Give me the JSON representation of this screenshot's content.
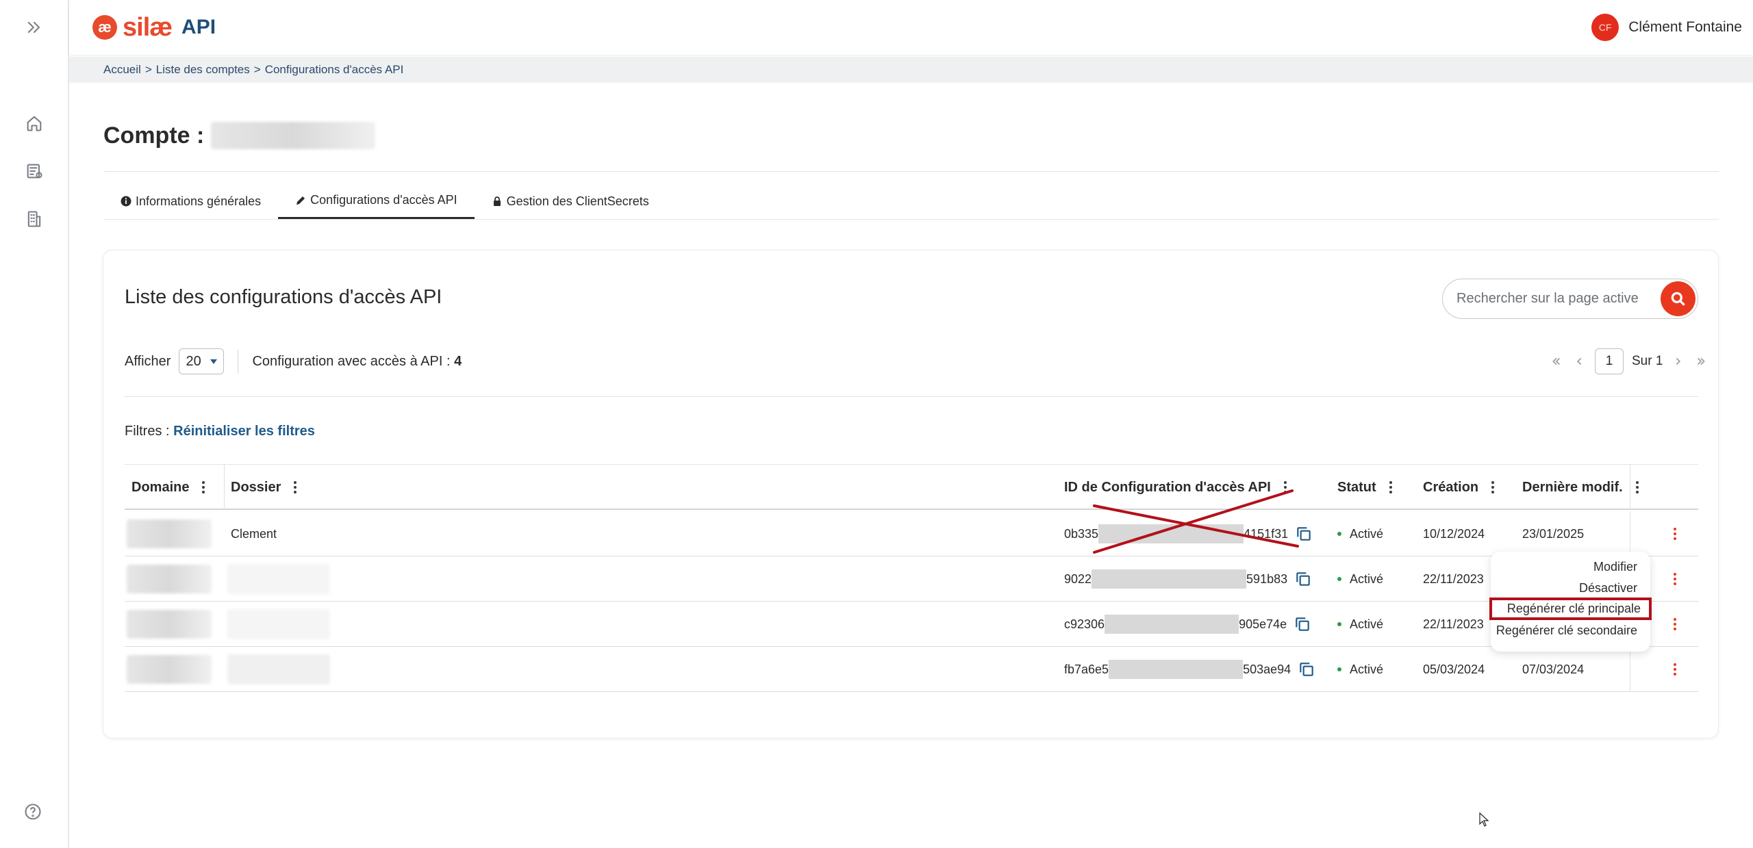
{
  "app": {
    "logo_mark": "æ",
    "logo_word": "silæ",
    "logo_suffix": "API"
  },
  "user": {
    "initials": "CF",
    "name": "Clément Fontaine"
  },
  "breadcrumb": [
    "Accueil",
    "Liste des comptes",
    "Configurations d'accès API"
  ],
  "breadcrumb_separator": ">",
  "page": {
    "title_prefix": "Compte :"
  },
  "tabs": [
    {
      "label": "Informations générales",
      "icon": "info-icon",
      "active": false
    },
    {
      "label": "Configurations d'accès API",
      "icon": "pencil-icon",
      "active": true
    },
    {
      "label": "Gestion des ClientSecrets",
      "icon": "lock-icon",
      "active": false
    }
  ],
  "card": {
    "title": "Liste des configurations d'accès API",
    "search_placeholder": "Rechercher sur la page active",
    "show_label": "Afficher",
    "show_value": "20",
    "count_label": "Configuration avec accès à API :",
    "count_value": "4",
    "pager_current": "1",
    "pager_total_label": "Sur 1",
    "filters_label": "Filtres :",
    "filters_reset": "Réinitialiser les filtres"
  },
  "table": {
    "headers": [
      "Domaine",
      "Dossier",
      "ID de Configuration d'accès API",
      "Statut",
      "Création",
      "Dernière modif."
    ],
    "rows": [
      {
        "dossier": "Clement",
        "id_start": "0b335",
        "id_end": "4151f31",
        "status": "Activé",
        "created": "10/12/2024",
        "modified": "23/01/2025"
      },
      {
        "dossier": "",
        "id_start": "9022",
        "id_end": "591b83",
        "status": "Activé",
        "created": "22/11/2023",
        "modified": ""
      },
      {
        "dossier": "",
        "id_start": "c92306",
        "id_end": "905e74e",
        "status": "Activé",
        "created": "22/11/2023",
        "modified": ""
      },
      {
        "dossier": "",
        "id_start": "fb7a6e5",
        "id_end": "503ae94",
        "status": "Activé",
        "created": "05/03/2024",
        "modified": "07/03/2024"
      }
    ]
  },
  "menu": {
    "items": [
      "Modifier",
      "Désactiver",
      "Regénérer clé principale",
      "Regénérer clé secondaire"
    ],
    "highlighted_index": 2
  },
  "colors": {
    "accent": "#e8391f",
    "brand_blue": "#1f4e79",
    "annotation_red": "#b2111b",
    "status_green": "#2e9b4a"
  }
}
